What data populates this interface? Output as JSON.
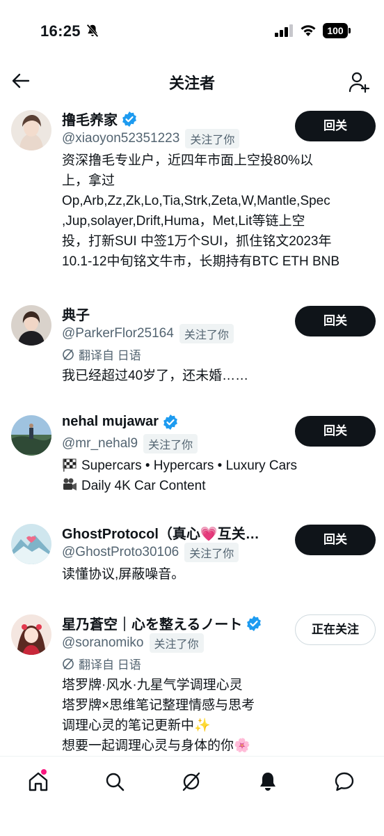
{
  "status_bar": {
    "time": "16:25",
    "battery": "100"
  },
  "header": {
    "title": "关注者"
  },
  "follows_you_label": "关注了你",
  "translate_label": "翻译自 日语",
  "users": [
    {
      "name": "撸毛养家",
      "handle": "@xiaoyon52351223",
      "verified": true,
      "button": "回关",
      "bio_lines": [
        "资深撸毛专业户，近四年市面上空投80%以",
        "上，拿过",
        "Op,Arb,Zz,Zk,Lo,Tia,Strk,Zeta,W,Mantle,Spec",
        ",Jup,solayer,Drift,Huma，Met,Lit等链上空",
        "投，打新SUI 中签1万个SUI，抓住铭文2023年",
        "10.1-12中旬铭文牛市，长期持有BTC ETH BNB"
      ]
    },
    {
      "name": "典子",
      "handle": "@ParkerFlor25164",
      "verified": false,
      "button": "回关",
      "bio_lines": [
        "我已经超过40岁了，还未婚……"
      ]
    },
    {
      "name": "nehal mujawar",
      "handle": "@mr_nehal9",
      "verified": true,
      "button": "回关",
      "bio_lines": [
        "Supercars • Hypercars • Luxury Cars",
        "Daily 4K Car Content"
      ],
      "bio_icons": [
        "checkered-flag-emoji",
        "movie-camera-emoji"
      ]
    },
    {
      "name": "GhostProtocol（真心💗互关…",
      "handle": "@GhostProto30106",
      "verified": false,
      "button": "回关",
      "bio_lines": [
        "读懂协议,屏蔽噪音。"
      ]
    },
    {
      "name": "星乃蒼空｜心を整えるノート",
      "handle": "@soranomiko",
      "verified": true,
      "button": "正在关注",
      "bio_lines": [
        "塔罗牌·风水·九星气学调理心灵",
        "塔罗牌×思维笔记整理情感与思考",
        "调理心灵的笔记更新中✨",
        "想要一起调理心灵与身体的你🌸"
      ]
    }
  ],
  "bottom_nav": [
    "home-icon",
    "search-icon",
    "grok-icon",
    "notifications-icon",
    "messages-icon"
  ],
  "colors": {
    "text": "#0f1419",
    "secondary": "#536471",
    "verified": "#1d9bf0",
    "notif_dot": "#f91880"
  }
}
